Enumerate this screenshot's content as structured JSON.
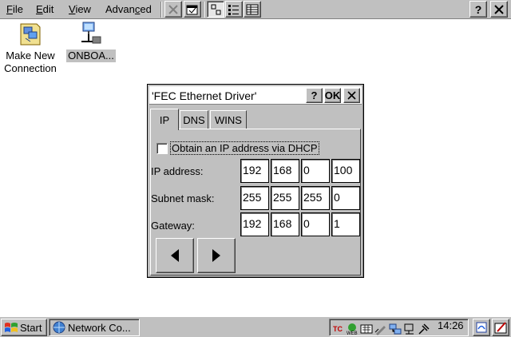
{
  "menubar": {
    "file": "File",
    "edit": "Edit",
    "view": "View",
    "advanced": "Advanced",
    "help_button": "?",
    "close_button": "X"
  },
  "desktop": {
    "icons": [
      {
        "label_line1": "Make New",
        "label_line2": "Connection",
        "icon": "make-new-connection-icon"
      },
      {
        "label": "ONBOA...",
        "icon": "network-adapter-icon",
        "selected": true
      }
    ]
  },
  "dialog": {
    "title": "'FEC Ethernet Driver'",
    "help_button": "?",
    "ok_button": "OK",
    "close_button": "✕",
    "tabs": [
      "IP",
      "DNS",
      "WINS"
    ],
    "active_tab": "IP",
    "dhcp_checkbox_label": "Obtain an IP address via DHCP",
    "dhcp_checked": false,
    "rows": [
      {
        "label": "IP address:",
        "octets": [
          "192",
          "168",
          "0",
          "100"
        ]
      },
      {
        "label": "Subnet mask:",
        "octets": [
          "255",
          "255",
          "255",
          "0"
        ]
      },
      {
        "label": "Gateway:",
        "octets": [
          "192",
          "168",
          "0",
          "1"
        ]
      }
    ],
    "prev_button_icon": "left-arrow-icon",
    "next_button_icon": "right-arrow-icon"
  },
  "taskbar": {
    "start_label": "Start",
    "task_label": "Network Co...",
    "clock": "14:26"
  },
  "colors": {
    "face": "#c0c0c0",
    "shadow": "#808080",
    "highlight": "#ffffff"
  }
}
